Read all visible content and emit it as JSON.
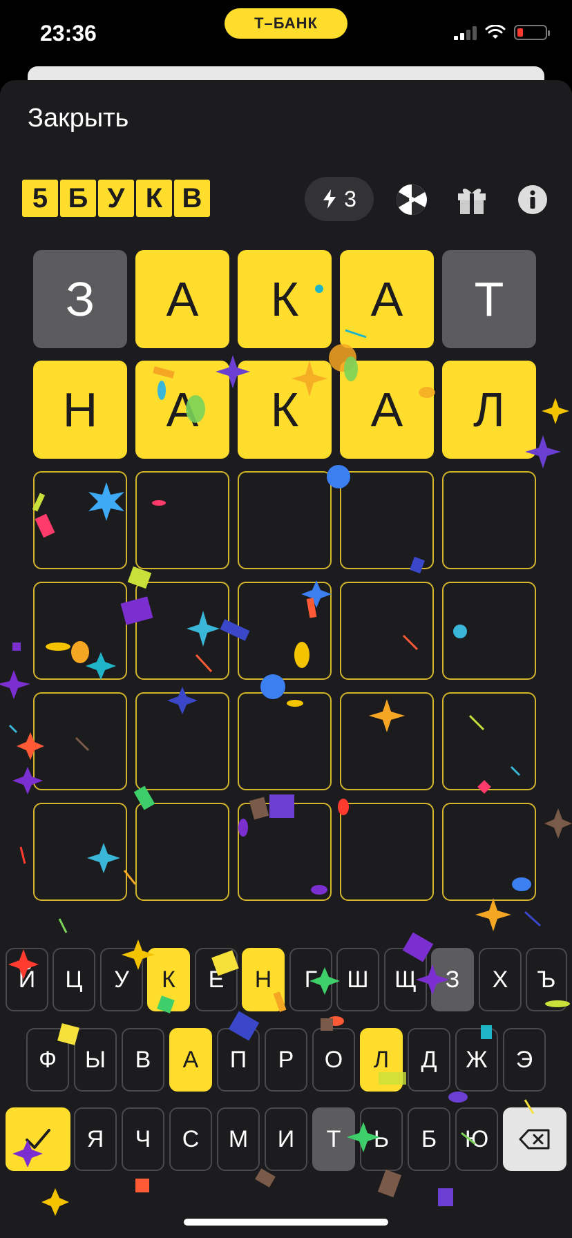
{
  "status": {
    "time": "23:36",
    "bank": "Т–БАНК"
  },
  "header": {
    "close_label": "Закрыть"
  },
  "logo_letters": [
    "5",
    "Б",
    "У",
    "К",
    "В"
  ],
  "energy": {
    "count": "3",
    "icon": "lightning-icon"
  },
  "toolbar_icons": [
    "wheel-icon",
    "gift-icon",
    "info-icon"
  ],
  "colors": {
    "correct": "#ffdd2d",
    "absent": "#5c5c5e",
    "empty_border": "#d4b72e",
    "background": "#1c1c1e"
  },
  "board": [
    [
      {
        "letter": "З",
        "state": "absent"
      },
      {
        "letter": "А",
        "state": "correct"
      },
      {
        "letter": "К",
        "state": "correct"
      },
      {
        "letter": "А",
        "state": "correct"
      },
      {
        "letter": "Т",
        "state": "absent"
      }
    ],
    [
      {
        "letter": "Н",
        "state": "correct"
      },
      {
        "letter": "А",
        "state": "correct"
      },
      {
        "letter": "К",
        "state": "correct"
      },
      {
        "letter": "А",
        "state": "correct"
      },
      {
        "letter": "Л",
        "state": "correct"
      }
    ],
    [
      {
        "letter": "",
        "state": "empty"
      },
      {
        "letter": "",
        "state": "empty"
      },
      {
        "letter": "",
        "state": "empty"
      },
      {
        "letter": "",
        "state": "empty"
      },
      {
        "letter": "",
        "state": "empty"
      }
    ],
    [
      {
        "letter": "",
        "state": "empty"
      },
      {
        "letter": "",
        "state": "empty"
      },
      {
        "letter": "",
        "state": "empty"
      },
      {
        "letter": "",
        "state": "empty"
      },
      {
        "letter": "",
        "state": "empty"
      }
    ],
    [
      {
        "letter": "",
        "state": "empty"
      },
      {
        "letter": "",
        "state": "empty"
      },
      {
        "letter": "",
        "state": "empty"
      },
      {
        "letter": "",
        "state": "empty"
      },
      {
        "letter": "",
        "state": "empty"
      }
    ],
    [
      {
        "letter": "",
        "state": "empty"
      },
      {
        "letter": "",
        "state": "empty"
      },
      {
        "letter": "",
        "state": "empty"
      },
      {
        "letter": "",
        "state": "empty"
      },
      {
        "letter": "",
        "state": "empty"
      }
    ]
  ],
  "keyboard": {
    "row1": [
      {
        "label": "Й",
        "state": "default"
      },
      {
        "label": "Ц",
        "state": "default"
      },
      {
        "label": "У",
        "state": "default"
      },
      {
        "label": "К",
        "state": "correct"
      },
      {
        "label": "Е",
        "state": "default"
      },
      {
        "label": "Н",
        "state": "correct"
      },
      {
        "label": "Г",
        "state": "default"
      },
      {
        "label": "Ш",
        "state": "default"
      },
      {
        "label": "Щ",
        "state": "default"
      },
      {
        "label": "З",
        "state": "absent"
      },
      {
        "label": "Х",
        "state": "default"
      },
      {
        "label": "Ъ",
        "state": "default"
      }
    ],
    "row2": [
      {
        "label": "Ф",
        "state": "default"
      },
      {
        "label": "Ы",
        "state": "default"
      },
      {
        "label": "В",
        "state": "default"
      },
      {
        "label": "А",
        "state": "correct"
      },
      {
        "label": "П",
        "state": "default"
      },
      {
        "label": "Р",
        "state": "default"
      },
      {
        "label": "О",
        "state": "default"
      },
      {
        "label": "Л",
        "state": "correct"
      },
      {
        "label": "Д",
        "state": "default"
      },
      {
        "label": "Ж",
        "state": "default"
      },
      {
        "label": "Э",
        "state": "default"
      }
    ],
    "row3": [
      {
        "label": "Я",
        "state": "default"
      },
      {
        "label": "Ч",
        "state": "default"
      },
      {
        "label": "С",
        "state": "default"
      },
      {
        "label": "М",
        "state": "default"
      },
      {
        "label": "И",
        "state": "default"
      },
      {
        "label": "Т",
        "state": "absent"
      },
      {
        "label": "Ь",
        "state": "default"
      },
      {
        "label": "Б",
        "state": "default"
      },
      {
        "label": "Ю",
        "state": "default"
      }
    ],
    "enter_icon": "checkmark-icon",
    "backspace_icon": "backspace-icon"
  }
}
